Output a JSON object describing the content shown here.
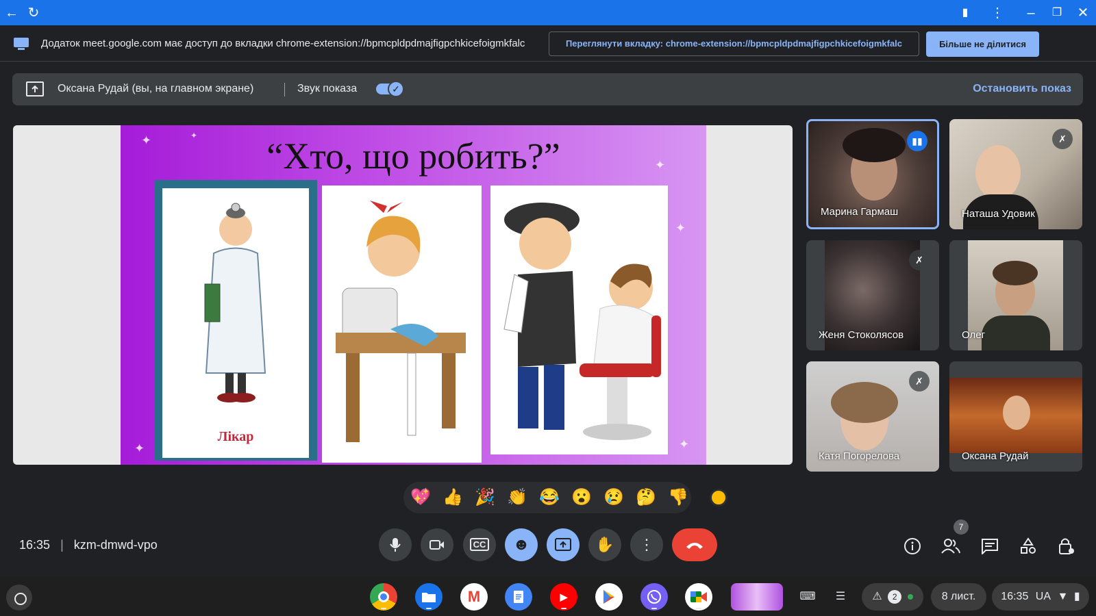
{
  "window": {
    "back_icon": "arrow-left-icon",
    "reload_icon": "reload-icon",
    "controls": [
      "camera-icon",
      "more-vert-icon",
      "minimize-icon",
      "restore-icon",
      "close-icon"
    ]
  },
  "infobar": {
    "message": "Додаток meet.google.com має доступ до вкладки chrome-extension://bpmcpldpdmajfigpchkicefoigmkfalc",
    "view_tab_label": "Переглянути вкладку: chrome-extension://bpmcpldpdmajfigpchkicefoigmkfalc",
    "stop_sharing_label": "Більше не ділитися"
  },
  "sharebar": {
    "presenter": "Оксана Рудай (вы, на главном экране)",
    "sound_label": "Звук показа",
    "sound_enabled": true,
    "stop_label": "Остановить показ"
  },
  "slide": {
    "title": "“Хто, що робить?”",
    "card1_label": "Лікар"
  },
  "participants": [
    {
      "name": "Марина Гармаш",
      "mic": "speaking",
      "active": true
    },
    {
      "name": "Наташа Удовик",
      "mic": "muted",
      "active": false
    },
    {
      "name": "Женя Стоколясов",
      "mic": "muted",
      "active": false
    },
    {
      "name": "Олег",
      "mic": "none",
      "active": false
    },
    {
      "name": "Катя Погорелова",
      "mic": "muted",
      "active": false
    },
    {
      "name": "Оксана Рудай",
      "mic": "none",
      "active": false
    }
  ],
  "reactions": [
    "💖",
    "👍",
    "🎉",
    "👏",
    "😂",
    "😮",
    "😢",
    "🤔",
    "👎"
  ],
  "meeting": {
    "time": "16:35",
    "code": "kzm-dmwd-vpo",
    "participant_count": "7"
  },
  "shelf": {
    "apps": [
      "Chrome",
      "Files",
      "Gmail",
      "Docs",
      "YouTube",
      "Play Store",
      "Viber",
      "Meet",
      "Thumbnail"
    ],
    "notification_count": "2",
    "date": "8 лист.",
    "clock": "16:35",
    "locale": "UA"
  },
  "colors": {
    "titlebar": "#1a73e8",
    "accent": "#8ab4f8",
    "end_call": "#ea4335",
    "bg": "#202124"
  }
}
